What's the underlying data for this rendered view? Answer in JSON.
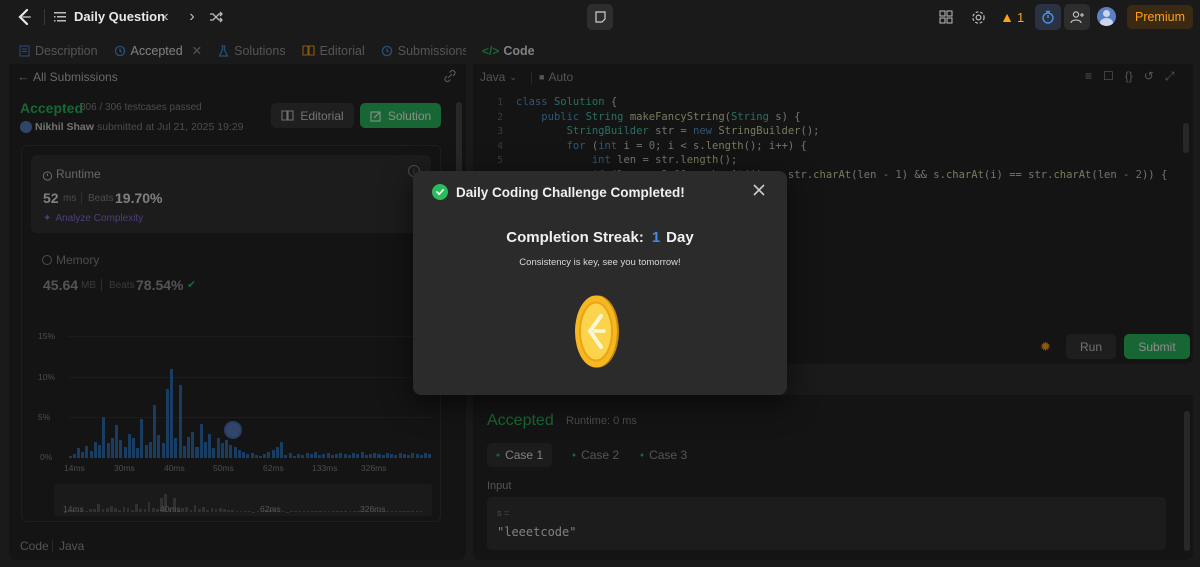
{
  "topbar": {
    "title": "Daily Question",
    "streak_count": "1",
    "premium_label": "Premium"
  },
  "left_panel": {
    "tabs": [
      {
        "label": "Description"
      },
      {
        "label": "Accepted"
      },
      {
        "label": "Solutions"
      },
      {
        "label": "Editorial"
      },
      {
        "label": "Submissions"
      }
    ],
    "back_label": "All Submissions",
    "status": "Accepted",
    "testcases": "306 / 306 testcases passed",
    "author": "Nikhil Shaw",
    "submitted_text": "submitted at Jul 21, 2025 19:29",
    "editorial_button": "Editorial",
    "solution_button": "Solution",
    "runtime": {
      "title": "Runtime",
      "value": "52",
      "unit": "ms",
      "beats_label": "Beats",
      "beats_value": "19.70%",
      "analyze_label": "Analyze Complexity"
    },
    "memory": {
      "title": "Memory",
      "value": "45.64",
      "unit": "MB",
      "beats_label": "Beats",
      "beats_value": "78.54%"
    },
    "chart_ticks_y": [
      "15%",
      "10%",
      "5%",
      "0%"
    ],
    "chart_ticks_x": [
      "14ms",
      "30ms",
      "40ms",
      "50ms",
      "62ms",
      "133ms",
      "326ms"
    ],
    "mini_ticks_x": [
      "14ms",
      "40ms",
      "62ms",
      "326ms"
    ],
    "footer_code": "Code",
    "footer_lang": "Java"
  },
  "chart_data": {
    "type": "bar",
    "title": "",
    "xlabel": "",
    "ylabel": "",
    "ylim": [
      0,
      15
    ],
    "values": [
      0.3,
      0.5,
      1.2,
      0.8,
      1.5,
      0.9,
      2.0,
      1.6,
      5.0,
      1.8,
      2.5,
      4.0,
      2.2,
      1.4,
      3.0,
      2.5,
      1.2,
      4.8,
      1.6,
      2.0,
      6.5,
      2.8,
      1.8,
      8.5,
      11.0,
      2.5,
      9.0,
      1.5,
      2.6,
      3.2,
      1.4,
      4.2,
      2.0,
      3.0,
      1.2,
      2.4,
      1.8,
      2.2,
      1.6,
      1.4,
      1.0,
      0.8,
      0.5,
      0.6,
      0.4,
      0.3,
      0.5,
      0.7,
      1.0,
      1.4,
      2.0,
      0.4,
      0.6,
      0.3,
      0.5,
      0.4,
      0.6,
      0.5,
      0.7,
      0.4,
      0.5,
      0.6,
      0.4,
      0.5,
      0.6,
      0.5,
      0.4,
      0.6,
      0.5,
      0.7,
      0.4,
      0.5,
      0.6,
      0.5,
      0.4,
      0.6,
      0.5,
      0.4,
      0.6,
      0.5,
      0.4,
      0.6,
      0.5,
      0.4,
      0.6,
      0.5
    ]
  },
  "code_panel": {
    "title": "Code",
    "language": "Java",
    "mode": "Auto",
    "lines": [
      {
        "n": "1",
        "html": "<span class='kw'>class</span> <span class='cls'>Solution</span> <span class='pl'>{</span>"
      },
      {
        "n": "2",
        "html": "    <span class='kw'>public</span> <span class='cls'>String</span> <span class='fn'>makeFancyString</span><span class='pl'>(</span><span class='cls'>String</span> <span class='pl'>s) {</span>"
      },
      {
        "n": "3",
        "html": "        <span class='cls'>StringBuilder</span> <span class='pl'>str = </span><span class='kw'>new</span> <span class='fn'>StringBuilder</span><span class='pl'>();</span>"
      },
      {
        "n": "4",
        "html": "        <span class='kw'>for</span> <span class='pl'>(</span><span class='kw'>int</span> <span class='pl'>i = </span><span class='num'>0</span><span class='pl'>; i &lt; s.</span><span class='fn'>length</span><span class='pl'>(); i++) {</span>"
      },
      {
        "n": "5",
        "html": "            <span class='kw'>int</span> <span class='pl'>len = str.</span><span class='fn'>length</span><span class='pl'>();</span>"
      },
      {
        "n": "6",
        "html": "            <span class='kw'>if</span> <span class='pl'>(len &gt;= </span><span class='num'>2</span> <span class='pl'>&amp;&amp; s.</span><span class='fn'>charAt</span><span class='pl'>(i) == str.</span><span class='fn'>charAt</span><span class='pl'>(len - </span><span class='num'>1</span><span class='pl'>) &amp;&amp; s.</span><span class='fn'>charAt</span><span class='pl'>(i) == str.</span><span class='fn'>charAt</span><span class='pl'>(len - </span><span class='num'>2</span><span class='pl'>)) {</span>"
      }
    ],
    "run_label": "Run",
    "submit_label": "Submit"
  },
  "result_panel": {
    "status": "Accepted",
    "runtime": "Runtime: 0 ms",
    "cases": [
      "Case 1",
      "Case 2",
      "Case 3"
    ],
    "input_label": "Input",
    "var_name": "s =",
    "var_value": "\"leeetcode\""
  },
  "modal": {
    "title": "Daily Coding Challenge Completed!",
    "streak_label": "Completion Streak:",
    "streak_value": "1",
    "streak_unit": "Day",
    "subtitle": "Consistency is key, see you tomorrow!"
  },
  "colors": {
    "accent_green": "#2cbb5d",
    "accent_blue": "#3b8eea",
    "orange": "#ffa116"
  }
}
